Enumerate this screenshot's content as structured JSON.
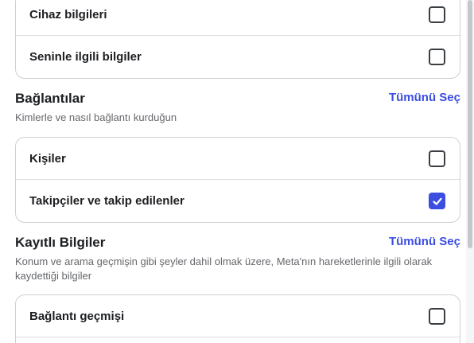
{
  "personal_info": {
    "items": [
      {
        "label": "Cihaz bilgileri",
        "checked": false
      },
      {
        "label": "Seninle ilgili bilgiler",
        "checked": false
      }
    ]
  },
  "connections": {
    "title": "Bağlantılar",
    "select_all_label": "Tümünü Seç",
    "description": "Kimlerle ve nasıl bağlantı kurduğun",
    "items": [
      {
        "label": "Kişiler",
        "checked": false
      },
      {
        "label": "Takipçiler ve takip edilenler",
        "checked": true
      }
    ]
  },
  "saved_info": {
    "title": "Kayıtlı Bilgiler",
    "select_all_label": "Tümünü Seç",
    "description": "Konum ve arama geçmişin gibi şeyler dahil olmak üzere, Meta'nın hareketlerinle ilgili olarak kaydettiği bilgiler",
    "items": [
      {
        "label": "Bağlantı geçmişi",
        "checked": false
      }
    ]
  },
  "colors": {
    "accent": "#3b4ee0",
    "border": "#ced0d4",
    "muted_text": "#65676b"
  }
}
